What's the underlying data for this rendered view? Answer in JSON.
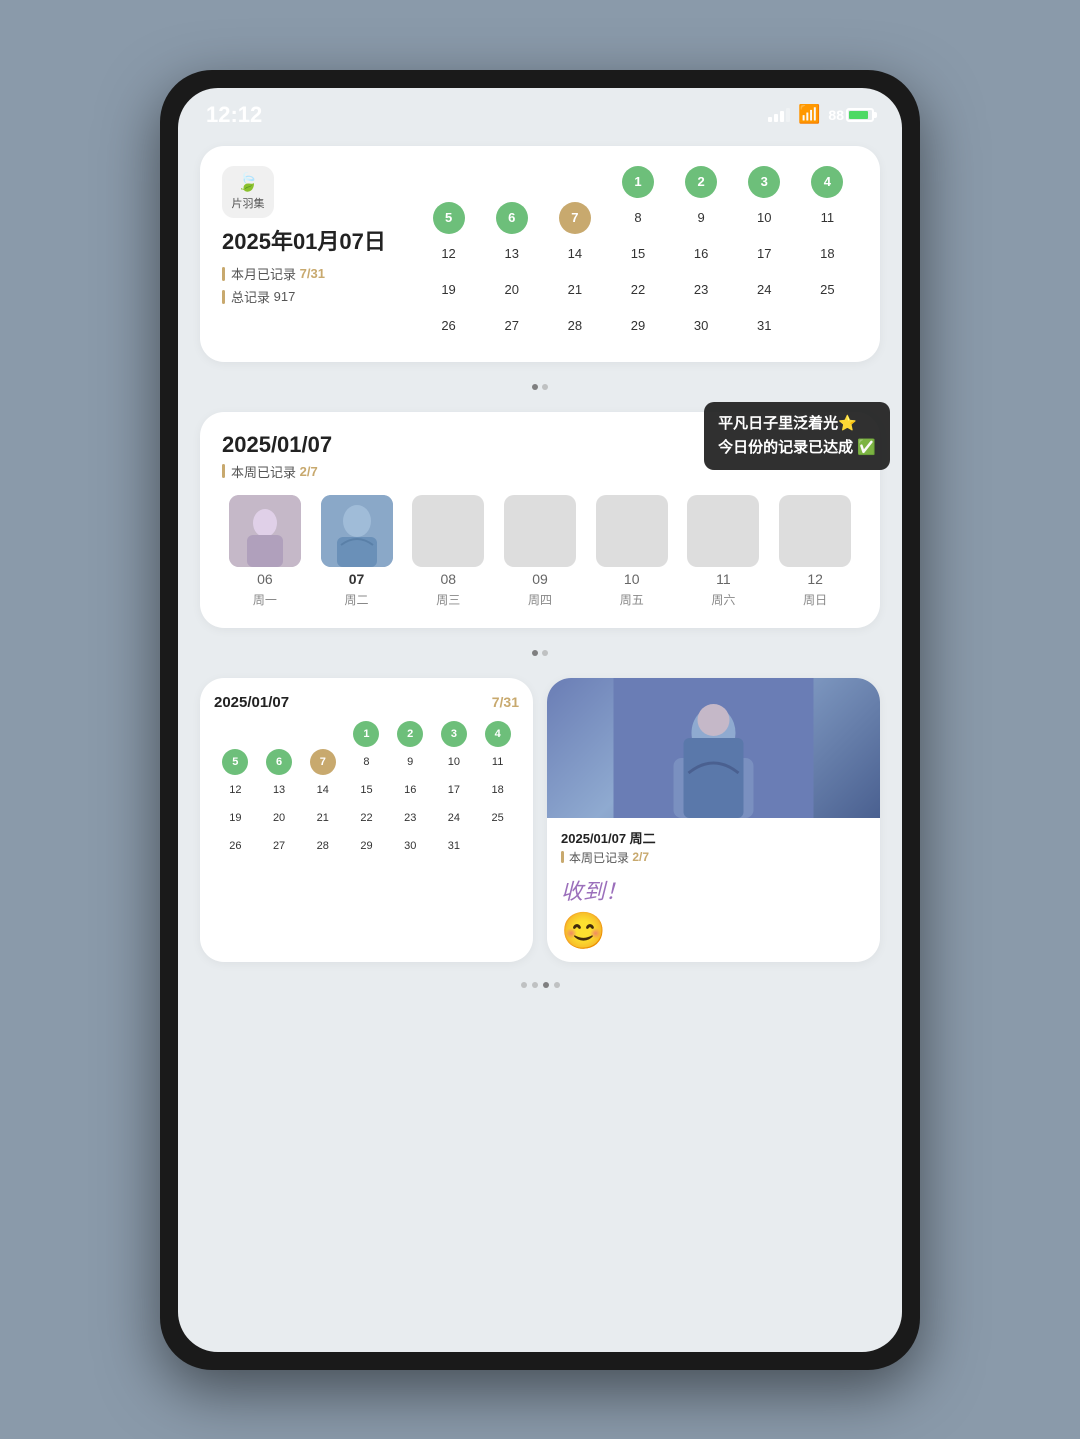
{
  "status_bar": {
    "time": "12:12",
    "battery_pct": "88",
    "battery_label": "88%"
  },
  "widget1": {
    "app_name": "片羽集",
    "app_emoji": "🍃",
    "date_label": "2025年01月07日",
    "monthly_stat": "本月已记录",
    "monthly_value": "7/31",
    "total_stat": "总记录",
    "total_value": "917",
    "calendar": {
      "days": [
        {
          "n": "",
          "type": "empty"
        },
        {
          "n": "",
          "type": "empty"
        },
        {
          "n": "",
          "type": "empty"
        },
        {
          "n": "1",
          "type": "green"
        },
        {
          "n": "2",
          "type": "green"
        },
        {
          "n": "3",
          "type": "green"
        },
        {
          "n": "4",
          "type": "green"
        },
        {
          "n": "5",
          "type": "green"
        },
        {
          "n": "6",
          "type": "green"
        },
        {
          "n": "7",
          "type": "tan"
        },
        {
          "n": "8",
          "type": "normal"
        },
        {
          "n": "9",
          "type": "normal"
        },
        {
          "n": "10",
          "type": "normal"
        },
        {
          "n": "11",
          "type": "normal"
        },
        {
          "n": "12",
          "type": "normal"
        },
        {
          "n": "13",
          "type": "normal"
        },
        {
          "n": "14",
          "type": "normal"
        },
        {
          "n": "15",
          "type": "normal"
        },
        {
          "n": "16",
          "type": "normal"
        },
        {
          "n": "17",
          "type": "normal"
        },
        {
          "n": "18",
          "type": "normal"
        },
        {
          "n": "19",
          "type": "normal"
        },
        {
          "n": "20",
          "type": "normal"
        },
        {
          "n": "21",
          "type": "normal"
        },
        {
          "n": "22",
          "type": "normal"
        },
        {
          "n": "23",
          "type": "normal"
        },
        {
          "n": "24",
          "type": "normal"
        },
        {
          "n": "25",
          "type": "normal"
        },
        {
          "n": "26",
          "type": "normal"
        },
        {
          "n": "27",
          "type": "normal"
        },
        {
          "n": "28",
          "type": "normal"
        },
        {
          "n": "29",
          "type": "normal"
        },
        {
          "n": "30",
          "type": "normal"
        },
        {
          "n": "31",
          "type": "normal"
        },
        {
          "n": "",
          "type": "empty"
        }
      ]
    }
  },
  "widget2": {
    "date_label": "2025/01/07",
    "weekly_stat": "本周已记录",
    "weekly_value": "2/7",
    "tooltip_line1": "平凡日子里泛着光⭐",
    "tooltip_line2": "今日份的记录已达成 ✅",
    "week_days": [
      {
        "num": "06",
        "label": "周一",
        "has_photo": true,
        "photo_class": "has-photo-1"
      },
      {
        "num": "07",
        "label": "周二",
        "has_photo": true,
        "photo_class": "has-photo-2",
        "is_today": true
      },
      {
        "num": "08",
        "label": "周三",
        "has_photo": false,
        "photo_class": ""
      },
      {
        "num": "09",
        "label": "周四",
        "has_photo": false,
        "photo_class": ""
      },
      {
        "num": "10",
        "label": "周五",
        "has_photo": false,
        "photo_class": ""
      },
      {
        "num": "11",
        "label": "周六",
        "has_photo": false,
        "photo_class": ""
      },
      {
        "num": "12",
        "label": "周日",
        "has_photo": false,
        "photo_class": ""
      }
    ]
  },
  "widget3": {
    "date_label": "2025/01/07",
    "count_label": "7/31",
    "calendar": {
      "days": [
        {
          "n": "",
          "type": "empty"
        },
        {
          "n": "",
          "type": "empty"
        },
        {
          "n": "",
          "type": "empty"
        },
        {
          "n": "1",
          "type": "green"
        },
        {
          "n": "2",
          "type": "green"
        },
        {
          "n": "3",
          "type": "green"
        },
        {
          "n": "4",
          "type": "green"
        },
        {
          "n": "5",
          "type": "green"
        },
        {
          "n": "6",
          "type": "green"
        },
        {
          "n": "7",
          "type": "tan"
        },
        {
          "n": "8",
          "type": "normal"
        },
        {
          "n": "9",
          "type": "normal"
        },
        {
          "n": "10",
          "type": "normal"
        },
        {
          "n": "11",
          "type": "normal"
        },
        {
          "n": "12",
          "type": "normal"
        },
        {
          "n": "13",
          "type": "normal"
        },
        {
          "n": "14",
          "type": "normal"
        },
        {
          "n": "15",
          "type": "normal"
        },
        {
          "n": "16",
          "type": "normal"
        },
        {
          "n": "17",
          "type": "normal"
        },
        {
          "n": "18",
          "type": "normal"
        },
        {
          "n": "19",
          "type": "normal"
        },
        {
          "n": "20",
          "type": "normal"
        },
        {
          "n": "21",
          "type": "normal"
        },
        {
          "n": "22",
          "type": "normal"
        },
        {
          "n": "23",
          "type": "normal"
        },
        {
          "n": "24",
          "type": "normal"
        },
        {
          "n": "25",
          "type": "normal"
        },
        {
          "n": "26",
          "type": "normal"
        },
        {
          "n": "27",
          "type": "normal"
        },
        {
          "n": "28",
          "type": "normal"
        },
        {
          "n": "29",
          "type": "normal"
        },
        {
          "n": "30",
          "type": "normal"
        },
        {
          "n": "31",
          "type": "normal"
        },
        {
          "n": "",
          "type": "empty"
        }
      ]
    }
  },
  "widget4": {
    "date_label": "2025/01/07  周二",
    "weekly_stat": "本周已记录",
    "weekly_value": "2/7",
    "handwriting": "收到！",
    "smiley": "😊"
  },
  "page_indicator": {
    "dots": [
      false,
      false,
      true,
      false
    ]
  }
}
